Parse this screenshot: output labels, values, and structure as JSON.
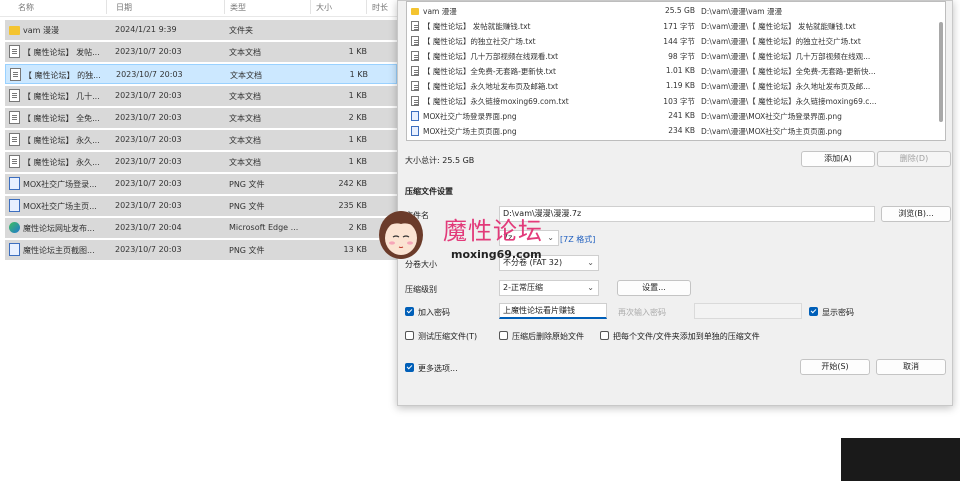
{
  "explorer": {
    "columns": [
      "名称",
      "日期",
      "类型",
      "大小",
      "时长"
    ],
    "rows": [
      {
        "icon": "folder-icon",
        "name": "vam 漫漫",
        "date": "2024/1/21 9:39",
        "type": "文件夹",
        "size": ""
      },
      {
        "icon": "text-file-icon",
        "name": "【 魔性论坛】 发帖...",
        "date": "2023/10/7 20:03",
        "type": "文本文档",
        "size": "1 KB"
      },
      {
        "icon": "text-file-icon",
        "name": "【 魔性论坛】 的独...",
        "date": "2023/10/7 20:03",
        "type": "文本文档",
        "size": "1 KB"
      },
      {
        "icon": "text-file-icon",
        "name": "【 魔性论坛】 几十...",
        "date": "2023/10/7 20:03",
        "type": "文本文档",
        "size": "1 KB"
      },
      {
        "icon": "text-file-icon",
        "name": "【 魔性论坛】 全免...",
        "date": "2023/10/7 20:03",
        "type": "文本文档",
        "size": "2 KB"
      },
      {
        "icon": "text-file-icon",
        "name": "【 魔性论坛】 永久...",
        "date": "2023/10/7 20:03",
        "type": "文本文档",
        "size": "1 KB"
      },
      {
        "icon": "text-file-icon",
        "name": "【 魔性论坛】 永久...",
        "date": "2023/10/7 20:03",
        "type": "文本文档",
        "size": "1 KB"
      },
      {
        "icon": "png-file-icon",
        "name": "MOX社交广场登录...",
        "date": "2023/10/7 20:03",
        "type": "PNG 文件",
        "size": "242 KB"
      },
      {
        "icon": "png-file-icon",
        "name": "MOX社交广场主页...",
        "date": "2023/10/7 20:03",
        "type": "PNG 文件",
        "size": "235 KB"
      },
      {
        "icon": "edge-icon",
        "name": "魔性论坛网址发布...",
        "date": "2023/10/7 20:04",
        "type": "Microsoft Edge ...",
        "size": "2 KB"
      },
      {
        "icon": "png-file-icon",
        "name": "魔性论坛主页截图...",
        "date": "2023/10/7 20:03",
        "type": "PNG 文件",
        "size": "13 KB"
      }
    ]
  },
  "dialog": {
    "files": [
      {
        "icon": "folder-icon",
        "name": "vam 漫漫",
        "size": "25.5 GB",
        "path": "D:\\vam\\漫漫\\vam 漫漫"
      },
      {
        "icon": "text-file-icon",
        "name": "【 魔性论坛】 发帖就能赚钱.txt",
        "size": "171 字节",
        "path": "D:\\vam\\漫漫\\【 魔性论坛】 发帖就能赚钱.txt"
      },
      {
        "icon": "text-file-icon",
        "name": "【 魔性论坛】的独立社交广场.txt",
        "size": "144 字节",
        "path": "D:\\vam\\漫漫\\【 魔性论坛】的独立社交广场.txt"
      },
      {
        "icon": "text-file-icon",
        "name": "【 魔性论坛】几十万部视频在线观看.txt",
        "size": "98 字节",
        "path": "D:\\vam\\漫漫\\【 魔性论坛】几十万部视频在线观..."
      },
      {
        "icon": "text-file-icon",
        "name": "【 魔性论坛】全免费-无套路-更新快.txt",
        "size": "1.01 KB",
        "path": "D:\\vam\\漫漫\\【 魔性论坛】全免费-无套路-更新快..."
      },
      {
        "icon": "text-file-icon",
        "name": "【 魔性论坛】永久地址发布页及邮箱.txt",
        "size": "1.19 KB",
        "path": "D:\\vam\\漫漫\\【 魔性论坛】永久地址发布页及邮..."
      },
      {
        "icon": "text-file-icon",
        "name": "【 魔性论坛】永久链接moxing69.com.txt",
        "size": "103 字节",
        "path": "D:\\vam\\漫漫\\【 魔性论坛】永久链接moxing69.c..."
      },
      {
        "icon": "png-file-icon",
        "name": "MOX社交广场登录界面.png",
        "size": "241 KB",
        "path": "D:\\vam\\漫漫\\MOX社交广场登录界面.png"
      },
      {
        "icon": "png-file-icon",
        "name": "MOX社交广场主页页面.png",
        "size": "234 KB",
        "path": "D:\\vam\\漫漫\\MOX社交广场主页页面.png"
      }
    ],
    "total_label": "大小总计: 25.5 GB",
    "add_button": "添加(A)",
    "delete_button": "删除(D)",
    "section_title": "压缩文件设置",
    "archive_name_label": "文件名",
    "archive_name_value": "D:\\vam\\漫漫\\漫漫.7z",
    "browse_button": "浏览(B)...",
    "format_label": "格式",
    "format_value": "7z",
    "format_note": "[7Z 格式]",
    "volume_label": "分卷大小",
    "volume_value": "不分卷 (FAT 32)",
    "level_label": "压缩级别",
    "level_value": "2-正常压缩",
    "settings_button": "设置...",
    "password_checkbox": "加入密码",
    "password_value": "上魔性论坛看片赚钱",
    "reenter_label": "再次输入密码",
    "show_password": "显示密码",
    "test_archive": "测试压缩文件(T)",
    "delete_after": "压缩后删除原始文件",
    "each_file_separate": "把每个文件/文件夹添加到单独的压缩文件",
    "more_options": "更多选项...",
    "start_button": "开始(S)",
    "cancel_button": "取消"
  },
  "watermark": {
    "text": "魔性论坛",
    "url": "moxing69.com"
  }
}
